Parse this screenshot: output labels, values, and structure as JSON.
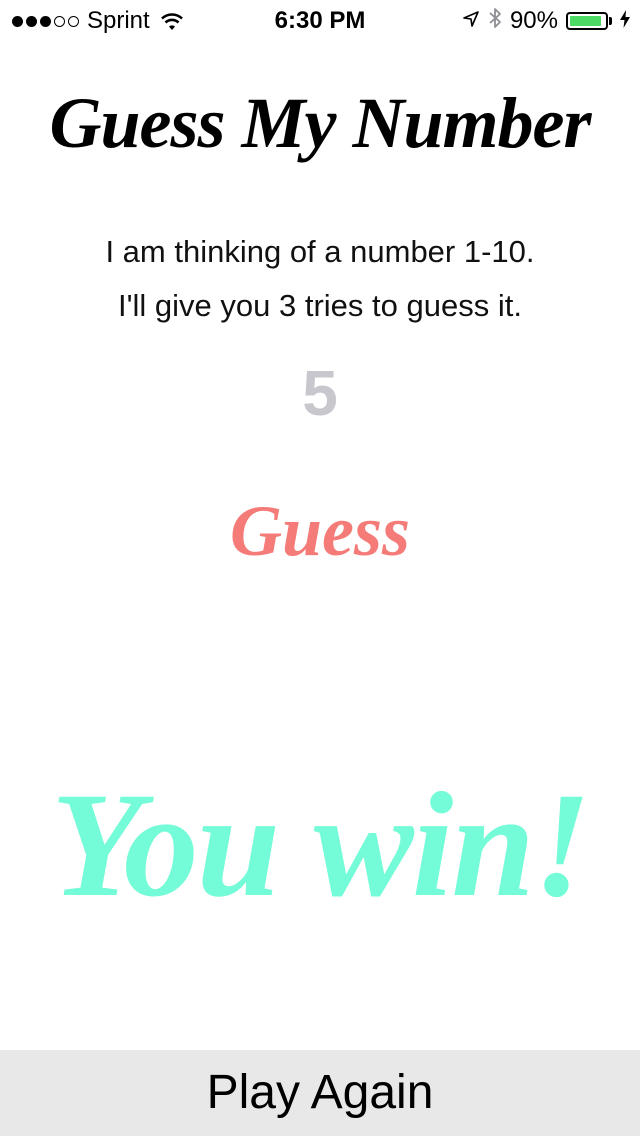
{
  "status_bar": {
    "signal_bars_on": 3,
    "signal_bars_total": 5,
    "carrier": "Sprint",
    "time": "6:30 PM",
    "battery_percent": "90%",
    "battery_level": 0.9,
    "battery_color": "#4cd964",
    "icons": [
      "wifi-icon",
      "location-arrow-icon",
      "bluetooth-icon",
      "battery-icon",
      "charging-bolt-icon"
    ]
  },
  "main": {
    "title": "Guess My Number",
    "intro_line1": "I am thinking of a number 1-10.",
    "intro_line2": "I'll give you 3 tries to guess it.",
    "guess_value": "5",
    "guess_button_label": "Guess",
    "result_message": "You win!"
  },
  "footer": {
    "play_again_label": "Play Again"
  },
  "colors": {
    "guess_button": "#f47b78",
    "result": "#74fbd7",
    "guess_value": "#c7c7cd",
    "footer_bg": "#e8e8e8"
  }
}
